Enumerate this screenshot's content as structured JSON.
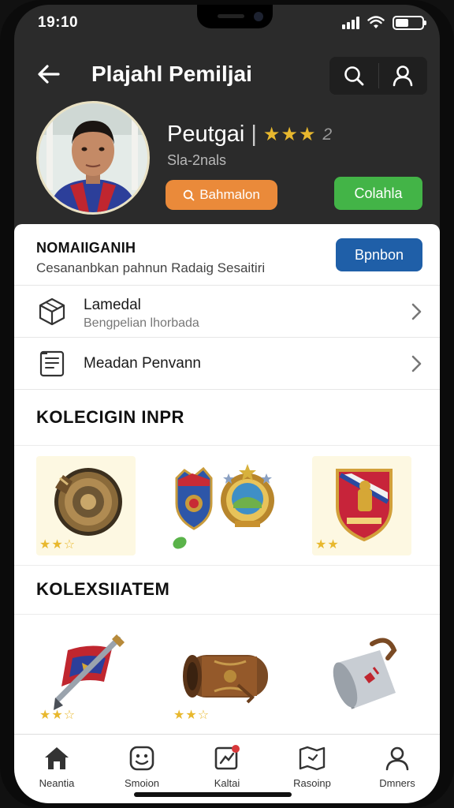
{
  "status_bar": {
    "time": "19:10"
  },
  "header": {
    "title": "Plajahl Pemiljai"
  },
  "profile": {
    "name": "Peutgai",
    "rating_stars": "★★★",
    "rating_count": "2",
    "subtitle": "Sla-2nals",
    "action_primary": "Bahmalon",
    "action_secondary": "Colahla"
  },
  "banner": {
    "title": "NOMAIIGANIH",
    "description": "Cesananbkan pahnun Radaig Sesaitiri",
    "button": "Bpnbon"
  },
  "menu_rows": [
    {
      "title": "Lamedal",
      "subtitle": "Bengpelian lhorbada"
    },
    {
      "title": "Meadan Penvann"
    }
  ],
  "sections": {
    "collection_1": {
      "title": "KOLECIGIN INPR",
      "items": [
        {
          "name": "bronze-shield",
          "stars": "★★☆"
        },
        {
          "name": "crest-pair",
          "stars": ""
        },
        {
          "name": "red-shield",
          "stars": "★★"
        }
      ]
    },
    "collection_2": {
      "title": "KOLEXSIIATEM",
      "items": [
        {
          "name": "mace-flag",
          "stars": "★★☆"
        },
        {
          "name": "leather-scroll",
          "stars": "★★☆"
        },
        {
          "name": "steel-mug",
          "stars": ""
        }
      ]
    }
  },
  "bottom_nav": [
    {
      "label": "Neantia",
      "icon": "home-icon"
    },
    {
      "label": "Smoion",
      "icon": "smile-icon"
    },
    {
      "label": "Kaltai",
      "icon": "chart-icon"
    },
    {
      "label": "Rasoinp",
      "icon": "map-icon"
    },
    {
      "label": "Dmners",
      "icon": "user-icon"
    }
  ],
  "colors": {
    "header_bg": "#2b2b2b",
    "orange": "#ea8a3a",
    "green": "#43b447",
    "blue": "#1f5fa8",
    "star": "#e8b82e"
  }
}
